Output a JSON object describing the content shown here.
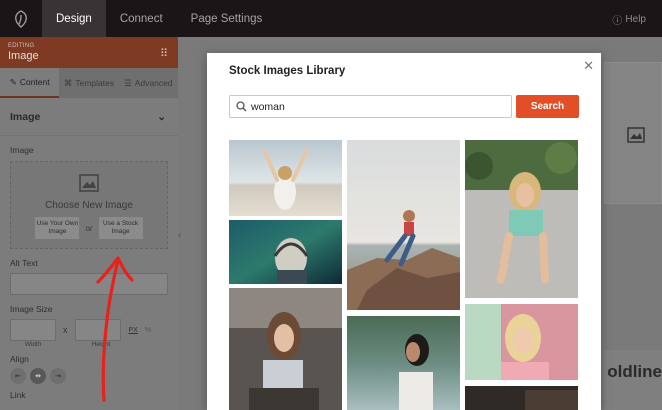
{
  "topnav": {
    "tabs": [
      {
        "label": "Design",
        "active": true
      },
      {
        "label": "Connect",
        "active": false
      },
      {
        "label": "Page Settings",
        "active": false
      }
    ],
    "help_label": "Help",
    "help_icon": "question-circle-icon"
  },
  "sidebar": {
    "editing_label": "EDITING",
    "element_name": "Image",
    "tabs": [
      "Content",
      "Templates",
      "Advanced"
    ],
    "section_title": "Image",
    "image_label": "Image",
    "choose_text": "Choose New Image",
    "use_own_label": "Use Your Own Image",
    "or_text": "or",
    "use_stock_label": "Use a Stock Image",
    "alt_text_label": "Alt Text",
    "image_size_label": "Image Size",
    "width_label": "Width",
    "height_label": "Height",
    "unit_px": "PX",
    "unit_pct": "%",
    "size_separator": "x",
    "align_label": "Align",
    "link_label": "Link"
  },
  "preview": {
    "heading_fragment": "oldline"
  },
  "modal": {
    "title": "Stock Images Library",
    "search_value": "woman",
    "search_button": "Search",
    "images": [
      "woman-raising-arms-beach",
      "woman-headphones-night",
      "woman-sitting-on-rocks-lake",
      "woman-green-top-sitting-sand",
      "woman-grey-top-window",
      "woman-white-top-lake",
      "blonde-woman-smiling-pink",
      "photo-partial"
    ]
  },
  "colors": {
    "accent": "#e24e26",
    "topbar": "#1c1517",
    "overlay_dim": "#7a7a7a"
  }
}
